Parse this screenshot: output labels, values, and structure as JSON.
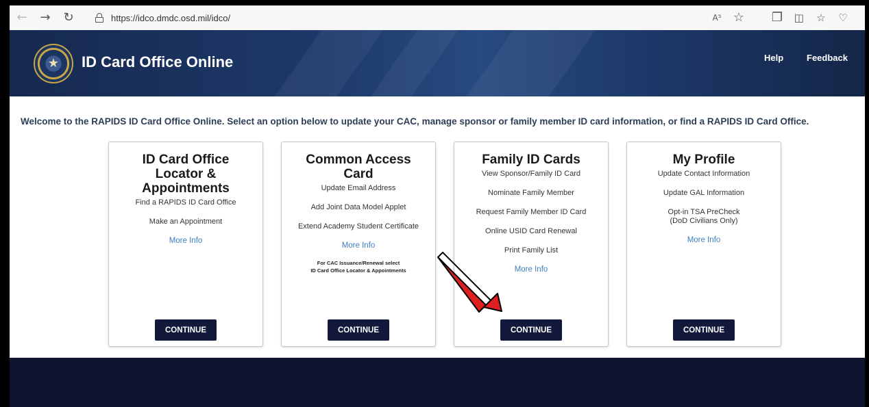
{
  "browser": {
    "url": "https://idco.dmdc.osd.mil/idco/",
    "icons": [
      "back-arrow-icon",
      "forward-arrow-icon",
      "refresh-icon",
      "lock-icon",
      "read-aloud-icon",
      "favorite-star-icon",
      "extensions-icon",
      "split-screen-icon",
      "favorites-list-icon",
      "health-icon"
    ]
  },
  "header": {
    "title": "ID Card Office Online",
    "help_label": "Help",
    "feedback_label": "Feedback"
  },
  "welcome_text": "Welcome to the RAPIDS ID Card Office Online. Select an option below to update your CAC, manage sponsor or family member ID card information, or find a RAPIDS ID Card Office.",
  "cards": [
    {
      "title_lines": [
        "ID Card Office",
        "Locator &",
        "Appointments"
      ],
      "items": [
        "Find a RAPIDS ID Card Office",
        "Make an Appointment"
      ],
      "more_info": "More Info",
      "continue_label": "CONTINUE"
    },
    {
      "title_lines": [
        "Common Access",
        "Card"
      ],
      "items": [
        "Update Email Address",
        "Add Joint Data Model Applet",
        "Extend Academy Student Certificate"
      ],
      "more_info": "More Info",
      "note_lines": [
        "For CAC Issuance/Renewal select",
        "ID Card Office Locator & Appointments"
      ],
      "continue_label": "CONTINUE"
    },
    {
      "title_lines": [
        "Family ID Cards"
      ],
      "items": [
        "View Sponsor/Family ID Card",
        "Nominate Family Member",
        "Request Family Member ID Card",
        "Online USID Card Renewal",
        "Print Family List"
      ],
      "more_info": "More Info",
      "continue_label": "CONTINUE"
    },
    {
      "title_lines": [
        "My Profile"
      ],
      "items": [
        "Update Contact Information",
        "Update GAL Information",
        "Opt-in TSA PreCheck\n(DoD Civilians Only)"
      ],
      "more_info": "More Info",
      "continue_label": "CONTINUE"
    }
  ],
  "colors": {
    "header_bg": "#1d3868",
    "continue_bg": "#13193a",
    "link": "#3f7ec2",
    "arrow": "#e02020",
    "footer_bg": "#0f142f"
  }
}
